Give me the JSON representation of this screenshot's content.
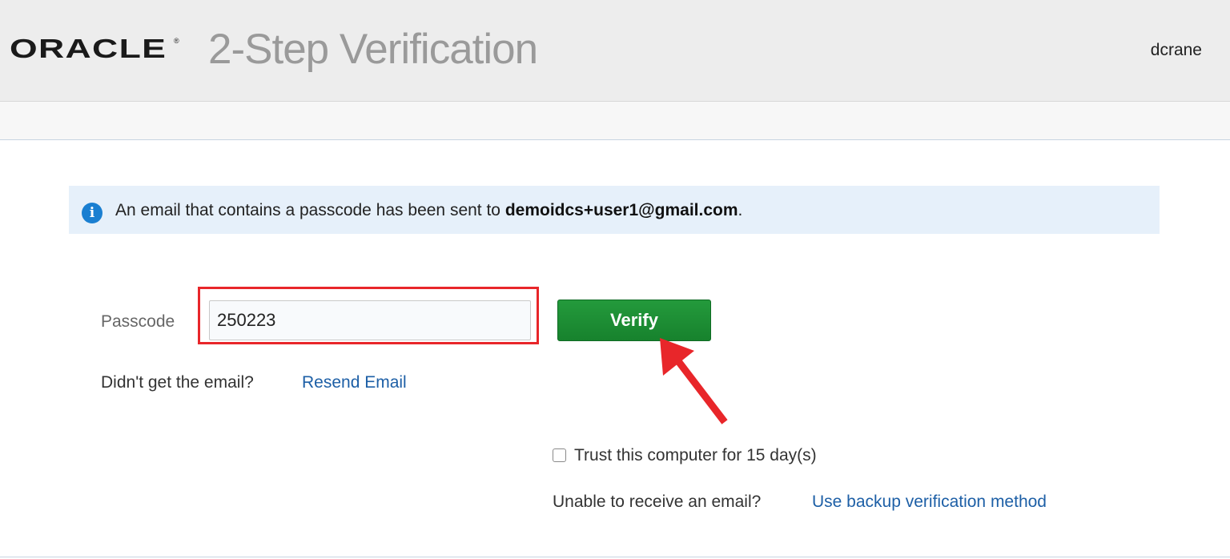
{
  "header": {
    "logo_text": "ORACLE",
    "logo_mark": "®",
    "title": "2-Step Verification",
    "username": "dcrane"
  },
  "banner": {
    "icon": "info-icon",
    "icon_glyph": "i",
    "message_prefix": "An email that contains a passcode has been sent to ",
    "email": "demoidcs+user1@gmail.com",
    "message_suffix": "."
  },
  "form": {
    "passcode_label": "Passcode",
    "passcode_value": "250223",
    "verify_label": "Verify",
    "resend_question": "Didn't get the email?",
    "resend_link": "Resend Email",
    "trust_label": "Trust this computer for 15 day(s)",
    "trust_checked": false,
    "unable_text": "Unable to receive an email?",
    "backup_link": "Use backup verification method"
  },
  "annotations": {
    "highlight_color": "#e8262a",
    "arrow_color": "#e8262a"
  },
  "colors": {
    "header_bg": "#ededed",
    "banner_bg": "#e6f0fa",
    "info_icon": "#1a7fd1",
    "verify_button": "#1e8e35",
    "link": "#1d5fa6"
  }
}
